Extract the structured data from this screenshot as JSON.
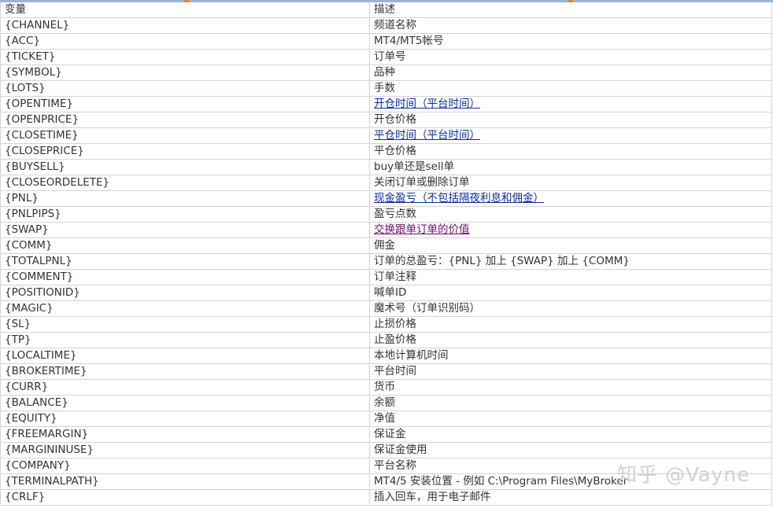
{
  "sheet": {
    "header": {
      "variable": "变量",
      "description": "描述"
    },
    "rows": [
      {
        "variable": "{CHANNEL}",
        "description": "频道名称",
        "style": ""
      },
      {
        "variable": "{ACC}",
        "description": "MT4/MT5帐号",
        "style": ""
      },
      {
        "variable": "{TICKET}",
        "description": "订单号",
        "style": ""
      },
      {
        "variable": "{SYMBOL}",
        "description": "品种",
        "style": ""
      },
      {
        "variable": "{LOTS}",
        "description": "手数",
        "style": ""
      },
      {
        "variable": "{OPENTIME}",
        "description": "开仓时间（平台时间）",
        "style": "link"
      },
      {
        "variable": "{OPENPRICE}",
        "description": "开仓价格",
        "style": ""
      },
      {
        "variable": "{CLOSETIME}",
        "description": "平仓时间（平台时间）",
        "style": "link"
      },
      {
        "variable": "{CLOSEPRICE}",
        "description": "平仓价格",
        "style": ""
      },
      {
        "variable": "{BUYSELL}",
        "description": "buy单还是sell单",
        "style": ""
      },
      {
        "variable": "{CLOSEORDELETE}",
        "description": "关闭订单或删除订单",
        "style": ""
      },
      {
        "variable": "{PNL}",
        "description": "现金盈亏（不包括隔夜利息和佣金）",
        "style": "link"
      },
      {
        "variable": "{PNLPIPS}",
        "description": "盈亏点数",
        "style": ""
      },
      {
        "variable": "{SWAP}",
        "description": "交换跟单订单的价值",
        "style": "visited"
      },
      {
        "variable": "{COMM}",
        "description": "佣金",
        "style": ""
      },
      {
        "variable": "{TOTALPNL}",
        "description": "订单的总盈亏：{PNL} 加上 {SWAP} 加上 {COMM}",
        "style": ""
      },
      {
        "variable": "{COMMENT}",
        "description": "订单注释",
        "style": ""
      },
      {
        "variable": "{POSITIONID}",
        "description": "喊单ID",
        "style": ""
      },
      {
        "variable": "{MAGIC}",
        "description": "魔术号（订单识别码）",
        "style": ""
      },
      {
        "variable": "{SL}",
        "description": "止损价格",
        "style": ""
      },
      {
        "variable": "{TP}",
        "description": "止盈价格",
        "style": ""
      },
      {
        "variable": "{LOCALTIME}",
        "description": "本地计算机时间",
        "style": ""
      },
      {
        "variable": "{BROKERTIME}",
        "description": "平台时间",
        "style": ""
      },
      {
        "variable": "{CURR}",
        "description": "货币",
        "style": ""
      },
      {
        "variable": "{BALANCE}",
        "description": "余额",
        "style": ""
      },
      {
        "variable": "{EQUITY}",
        "description": "净值",
        "style": ""
      },
      {
        "variable": "{FREEMARGIN}",
        "description": "保证金",
        "style": ""
      },
      {
        "variable": "{MARGININUSE}",
        "description": "保证金使用",
        "style": ""
      },
      {
        "variable": "{COMPANY}",
        "description": "平台名称",
        "style": ""
      },
      {
        "variable": "{TERMINALPATH}",
        "description": "MT4/5 安装位置 - 例如 C:\\Program Files\\MyBroker",
        "style": ""
      },
      {
        "variable": "{CRLF}",
        "description": "插入回车，用于电子邮件",
        "style": ""
      }
    ]
  },
  "watermark": "知乎 @Vayne",
  "colors": {
    "link": "#0b2f9c",
    "visited_link": "#6b0e6b",
    "grid": "#d4d4d4",
    "text": "#333333"
  }
}
